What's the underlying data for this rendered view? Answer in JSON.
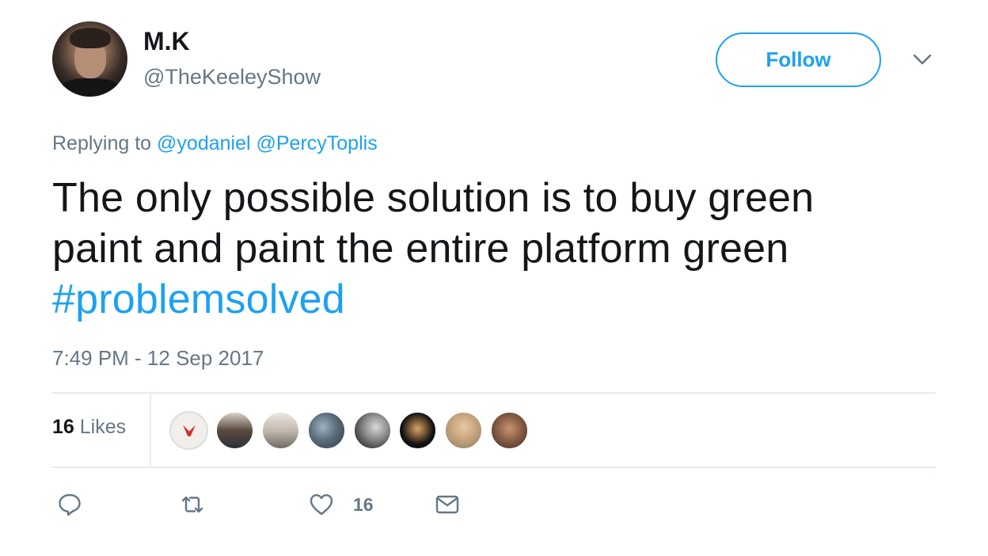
{
  "author": {
    "name": "M.K",
    "handle": "@TheKeeleyShow"
  },
  "header": {
    "follow_label": "Follow"
  },
  "reply": {
    "prefix": "Replying to",
    "mentions": [
      "@yodaniel",
      "@PercyToplis"
    ]
  },
  "tweet": {
    "line1": "The only possible solution is to buy green",
    "line2": "paint and paint the entire platform green",
    "hashtag": "#problemsolved",
    "timestamp": "7:49 PM - 12 Sep 2017"
  },
  "stats": {
    "likes_count": "16",
    "likes_word": "Likes",
    "liker_avatar_count": 8
  },
  "actions": {
    "reply_icon": "reply-icon",
    "retweet_icon": "retweet-icon",
    "like_icon": "heart-icon",
    "like_count": "16",
    "dm_icon": "envelope-icon"
  },
  "colors": {
    "accent": "#1da1f2",
    "text_primary": "#14171a",
    "text_secondary": "#657786",
    "divider": "#e6ecf0"
  }
}
